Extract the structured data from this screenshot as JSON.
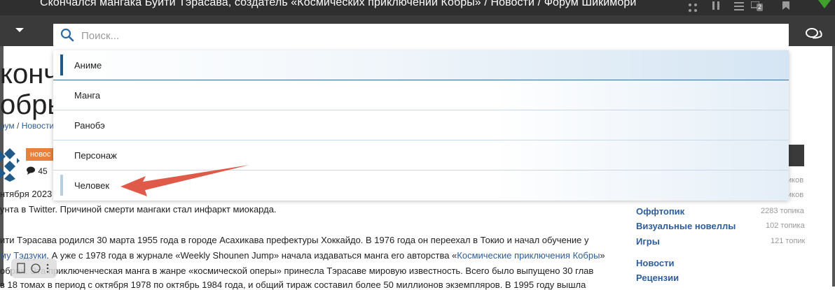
{
  "window": {
    "title": "Скончался мангака Буити Тэрасава, создатель «Космических приключений Кобры» / Новости / Форум Шикимори",
    "badge_count": "2"
  },
  "search": {
    "placeholder": "Поиск..."
  },
  "dropdown": {
    "items": [
      {
        "label": "Аниме"
      },
      {
        "label": "Манга"
      },
      {
        "label": "Ранобэ"
      },
      {
        "label": "Персонаж"
      },
      {
        "label": "Человек"
      }
    ]
  },
  "background_page": {
    "title_line1": "кончал",
    "title_line2": "обры",
    "breadcrumb_1": "рум",
    "breadcrumb_sep": "/",
    "breadcrumb_2": "Новости",
    "tag": "новос",
    "comments_count": "45",
    "date": "нтября 2023",
    "line_1": "унта в Twitter. Причиной смерти мангаки стал инфаркт миокарда.",
    "line_2": "ити Тэрасава родился 30 марта 1955 года в городе Асахикава префектуры Хоккайдо. В 1976 года он переехал в Токио и начал обучение у",
    "line_3_link": "му Тэдзуки",
    "line_3_text": ". А уже с 1978 года в журнале «Weekly Shounen Jump» начала издаваться манга его авторства «",
    "line_3_link2": "Космические приключения Кобры",
    "line_3_end": "»",
    "line_4": "обраx. Эта приключенческая манга в жанре «космической оперы» принесла Тэрасаве мировую известность. Всего было выпущено 30 глав",
    "line_5": "в 18 томах в период с октября 1978 по октябрь 1984 года, и общий тираж составил более 50 миллионов экземпляров. В 1995 году вышла"
  },
  "sidebar": {
    "count_1": "иков",
    "count_2": "иков",
    "items": [
      {
        "label": "Оффтопик",
        "count": "2283 топика"
      },
      {
        "label": "Визуальные новеллы",
        "count": "102 топика"
      },
      {
        "label": "Игры",
        "count": "121 топик"
      },
      {
        "label": "Новости",
        "count": ""
      },
      {
        "label": "Рецензии",
        "count": ""
      }
    ]
  },
  "colors": {
    "topbar": "#2f2f2f",
    "searchbar": "#3a3a3a",
    "accent_bar": "#1f5a89",
    "link": "#2d5d9b",
    "tag": "#e8813b",
    "arrow": "#e05a4a"
  }
}
